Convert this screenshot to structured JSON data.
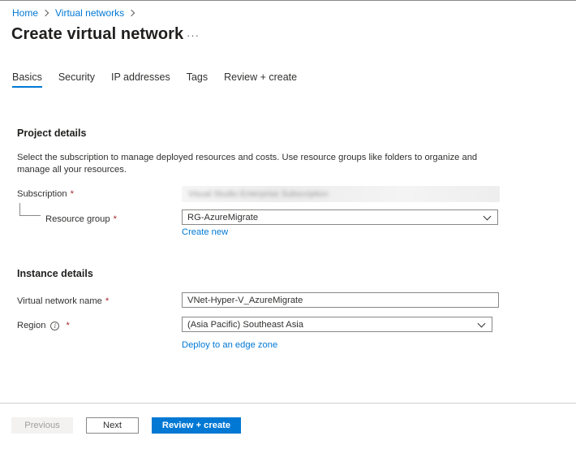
{
  "breadcrumb": {
    "items": [
      "Home",
      "Virtual networks"
    ]
  },
  "page": {
    "title": "Create virtual network",
    "more_label": "···"
  },
  "tabs": [
    {
      "label": "Basics",
      "active": true
    },
    {
      "label": "Security",
      "active": false
    },
    {
      "label": "IP addresses",
      "active": false
    },
    {
      "label": "Tags",
      "active": false
    },
    {
      "label": "Review + create",
      "active": false
    }
  ],
  "project_details": {
    "heading": "Project details",
    "description": "Select the subscription to manage deployed resources and costs. Use resource groups like folders to organize and manage all your resources.",
    "subscription": {
      "label": "Subscription",
      "required_mark": "*",
      "value": "Visual Studio Enterprise Subscription"
    },
    "resource_group": {
      "label": "Resource group",
      "required_mark": "*",
      "value": "RG-AzureMigrate",
      "create_new_link": "Create new"
    }
  },
  "instance_details": {
    "heading": "Instance details",
    "vnet_name": {
      "label": "Virtual network name",
      "required_mark": "*",
      "value": "VNet-Hyper-V_AzureMigrate"
    },
    "region": {
      "label": "Region",
      "info_icon": "i",
      "required_mark": "*",
      "value": "(Asia Pacific) Southeast Asia",
      "edge_zone_link": "Deploy to an edge zone"
    }
  },
  "footer": {
    "previous_label": "Previous",
    "next_label": "Next",
    "review_label": "Review + create"
  },
  "colors": {
    "accent": "#0078d4",
    "required": "#a4262c"
  }
}
